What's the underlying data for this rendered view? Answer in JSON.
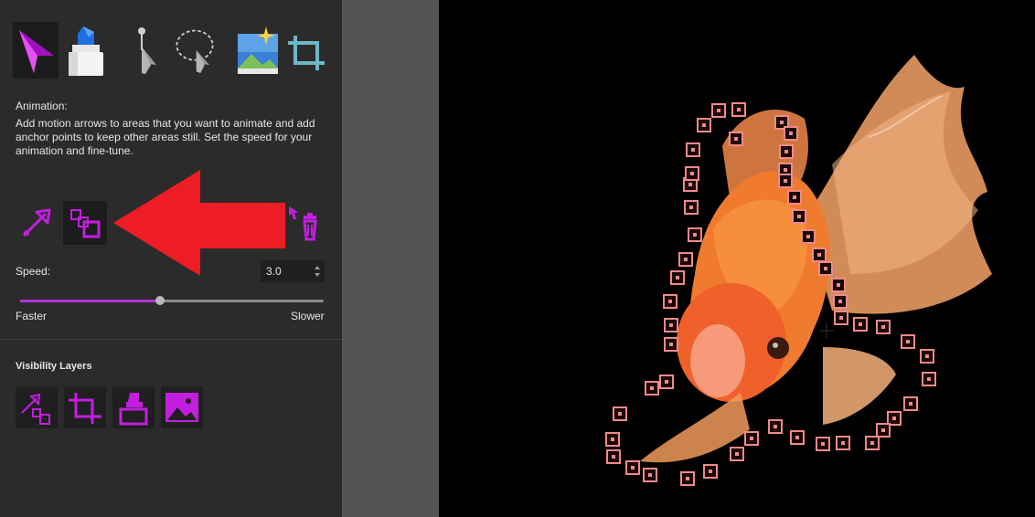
{
  "tools": [
    {
      "name": "animation-tool-icon",
      "selected": true
    },
    {
      "name": "mask-brush-tool-icon",
      "selected": false
    },
    {
      "name": "pointer-tool-icon",
      "selected": false
    },
    {
      "name": "lasso-select-tool-icon",
      "selected": false
    },
    {
      "name": "sky-replacement-tool-icon",
      "selected": false
    },
    {
      "name": "crop-tool-icon",
      "selected": false
    }
  ],
  "animation": {
    "heading": "Animation:",
    "description": "Add motion arrows to areas that you want to animate and add anchor points to keep other areas still. Set the speed for your animation and fine-tune."
  },
  "speed": {
    "label": "Speed:",
    "value": "3.0",
    "min_label": "Faster",
    "max_label": "Slower",
    "slider_fraction": 0.46
  },
  "visibility": {
    "heading": "Visibility Layers",
    "layers": [
      "animation-layer-icon",
      "crop-layer-icon",
      "mask-layer-icon",
      "image-layer-icon"
    ]
  },
  "colors": {
    "accent": "#b62fd6",
    "magenta_icon": "#c21ee0",
    "annotation_arrow": "#ee1c24",
    "anchor_point": "#f08a8a"
  }
}
